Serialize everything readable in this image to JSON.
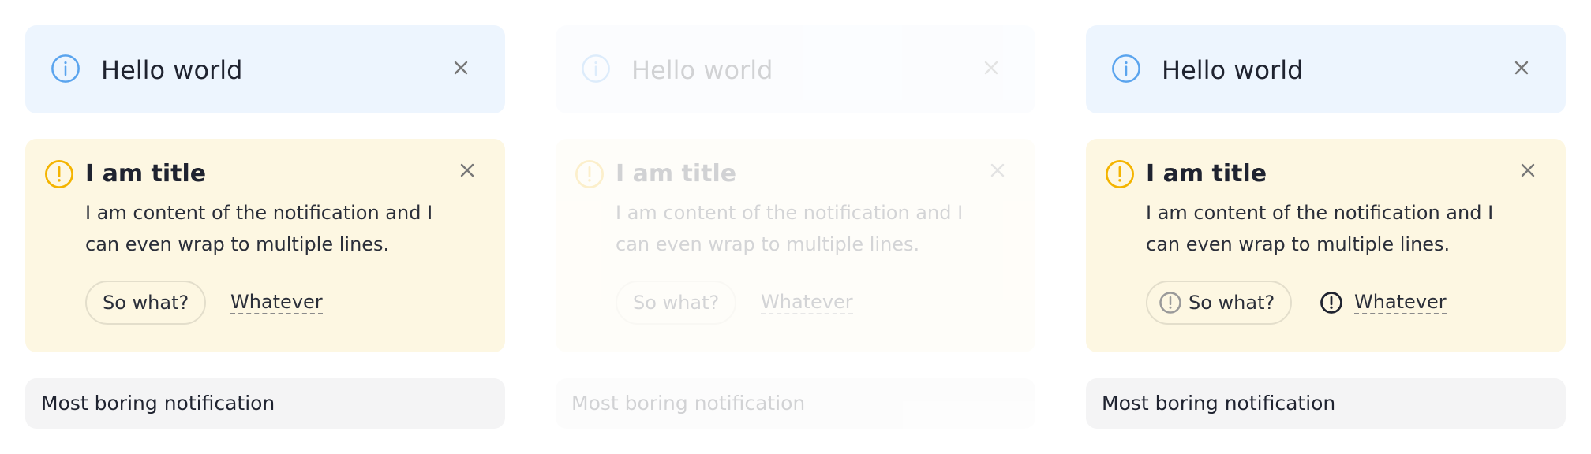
{
  "colors": {
    "info_bg": "#edf5fe",
    "info_icon": "#5aa4ee",
    "warn_bg": "#fdf7e2",
    "warn_icon": "#f4b400",
    "plain_bg": "#f4f4f5"
  },
  "variants": [
    {
      "info": {
        "icon": "info-circle-icon",
        "title": "Hello world",
        "close_icon": "close-icon"
      },
      "warning": {
        "icon": "exclamation-circle-icon",
        "title": "I am title",
        "content": "I am content of the notification and I can even wrap to multiple lines.",
        "action_primary": "So what?",
        "action_link": "Whatever",
        "close_icon": "close-icon"
      },
      "plain": {
        "title": "Most boring notification"
      }
    },
    {
      "info": {
        "icon": "info-circle-icon",
        "title": "Hello world",
        "close_icon": "close-icon"
      },
      "warning": {
        "icon": "exclamation-circle-icon",
        "title": "I am title",
        "content": "I am content of the notification and I can even wrap to multiple lines.",
        "action_primary": "So what?",
        "action_link": "Whatever",
        "close_icon": "close-icon"
      },
      "plain": {
        "title": "Most boring notification"
      }
    },
    {
      "info": {
        "icon": "info-circle-icon",
        "title": "Hello world",
        "close_icon": "close-icon"
      },
      "warning": {
        "icon": "exclamation-circle-icon",
        "title": "I am title",
        "content": "I am content of the notification and I can even wrap to multiple lines.",
        "action_primary": "So what?",
        "action_link": "Whatever",
        "close_icon": "close-icon",
        "action_icons": "exclamation-circle-icon"
      },
      "plain": {
        "title": "Most boring notification"
      }
    }
  ]
}
